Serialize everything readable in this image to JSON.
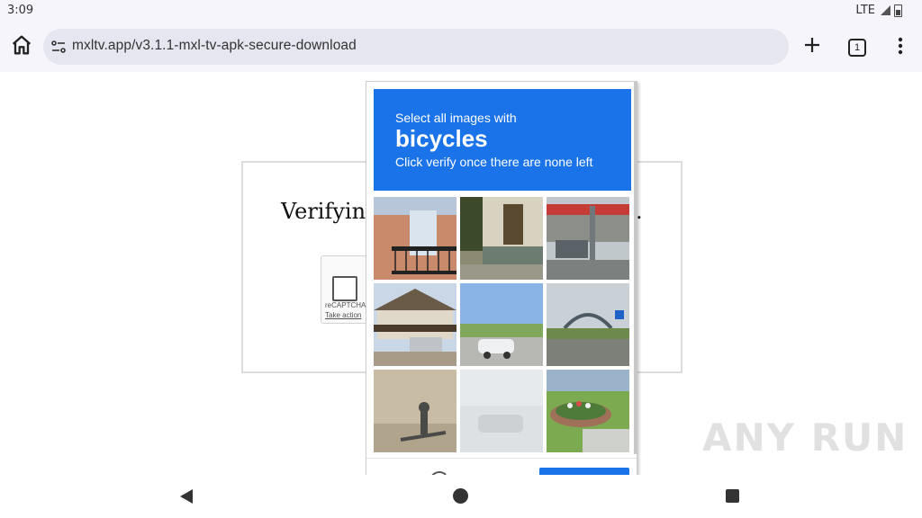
{
  "status_bar": {
    "time": "3:09",
    "network": "LTE"
  },
  "browser": {
    "url": "mxltv.app/v3.1.1-mxl-tv-apk-secure-download",
    "tab_count": "1"
  },
  "page": {
    "verify_text": "Verifying",
    "verify_suffix": "."
  },
  "recaptcha_widget": {
    "name": "reCAPTCHA",
    "action_text": "Take action"
  },
  "challenge": {
    "instruction": "Select all images with",
    "target": "bicycles",
    "subtext": "Click verify once there are none left",
    "tiles": [
      {
        "name": "tile-building-balcony"
      },
      {
        "name": "tile-house-entrance"
      },
      {
        "name": "tile-gas-station"
      },
      {
        "name": "tile-carport-house"
      },
      {
        "name": "tile-parked-cars-field"
      },
      {
        "name": "tile-bridge-road"
      },
      {
        "name": "tile-shadow-road"
      },
      {
        "name": "tile-faded-parking"
      },
      {
        "name": "tile-flower-bed"
      }
    ]
  },
  "watermark": "ANY RUN",
  "colors": {
    "accent": "#1a73e8",
    "toolbar_bg": "#f5f5fb",
    "url_bg": "#e6e6f0"
  }
}
